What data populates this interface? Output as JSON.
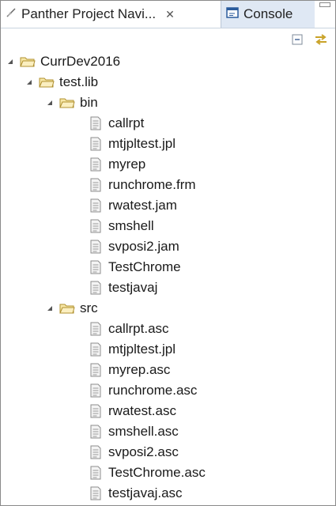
{
  "tabs": {
    "navigator_label": "Panther Project Navi...",
    "close_glyph": "✕",
    "console_label": "Console"
  },
  "tree": {
    "root": "CurrDev2016",
    "child": "test.lib",
    "bin": {
      "label": "bin",
      "files": [
        "callrpt",
        "mtjpltest.jpl",
        "myrep",
        "runchrome.frm",
        "rwatest.jam",
        "smshell",
        "svposi2.jam",
        "TestChrome",
        "testjavaj"
      ]
    },
    "src": {
      "label": "src",
      "files": [
        "callrpt.asc",
        "mtjpltest.jpl",
        "myrep.asc",
        "runchrome.asc",
        "rwatest.asc",
        "smshell.asc",
        "svposi2.asc",
        "TestChrome.asc",
        "testjavaj.asc"
      ]
    }
  },
  "icons": {
    "navigator_tab": "navigator-icon",
    "console_tab": "console-icon",
    "collapse_all": "collapse-all-icon",
    "link_editor": "link-with-editor-icon",
    "folder": "folder-icon",
    "file": "file-icon"
  },
  "colors": {
    "active_tab_bg": "#ffffff",
    "inactive_tab_bg": "#dfe8f4",
    "folder_fill": "#f7e7a6",
    "folder_stroke": "#b0902f"
  }
}
